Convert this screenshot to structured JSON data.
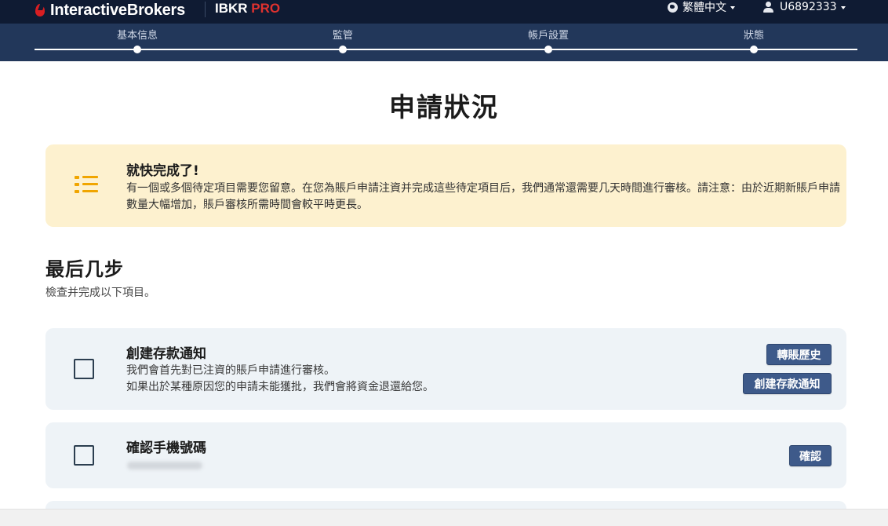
{
  "header": {
    "logo_text": "InteractiveBrokers",
    "product_main": "IBKR",
    "product_suffix": "PRO",
    "language": "繁體中文",
    "account_id": "U6892333",
    "icons": {
      "language": "globe-icon",
      "user": "user-icon",
      "menu_caret": "caret-down-icon"
    }
  },
  "steps": [
    {
      "label": "基本信息"
    },
    {
      "label": "監管"
    },
    {
      "label": "帳戶設置"
    },
    {
      "label": "狀態"
    }
  ],
  "page": {
    "title": "申請狀況"
  },
  "notice": {
    "icon": "checklist-icon",
    "title": "就快完成了!",
    "text": "有一個或多個待定項目需要您留意。在您為賬戶申請注資并完成這些待定項目后，我們通常還需要几天時間進行審核。請注意：由於近期新賬戶申請數量大幅增加，賬戶審核所需時間會較平時更長。"
  },
  "section": {
    "title": "最后几步",
    "subtitle": "檢查并完成以下項目。"
  },
  "tasks": [
    {
      "title": "創建存款通知",
      "desc_line1": "我們會首先對已注資的賬戶申請進行審核。",
      "desc_line2": "如果出於某種原因您的申請未能獲批，我們會將資金退還給您。",
      "buttons": [
        "轉賬歷史",
        "創建存款通知"
      ],
      "checked": false
    },
    {
      "title": "確認手機號碼",
      "buttons": [
        "確認"
      ],
      "checked": false
    }
  ],
  "colors": {
    "nav_bg": "#0f1b33",
    "stepper_bg": "#22375a",
    "brand_red": "#d81e22",
    "notice_bg": "#fdf1cf",
    "notice_icon": "#f0a500",
    "card_bg": "#eef3f7",
    "button_bg": "#3e5a8a"
  }
}
